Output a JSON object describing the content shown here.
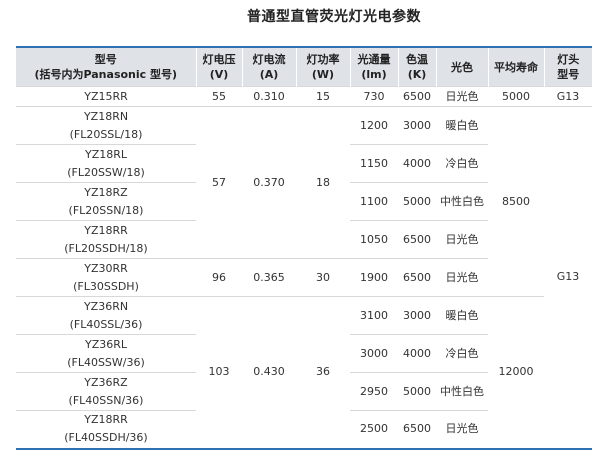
{
  "title": "普通型直管荧光灯光电参数",
  "headers": {
    "model": "型号",
    "model_sub": "(括号内为Panasonic 型号)",
    "voltage": "灯电压",
    "voltage_unit": "(V)",
    "current": "灯电流",
    "current_unit": "(A)",
    "power": "灯功率",
    "power_unit": "(W)",
    "flux": "光通量",
    "flux_unit": "(lm)",
    "cct": "色温",
    "cct_unit": "(K)",
    "color": "光色",
    "life": "平均寿命",
    "base": "灯头",
    "base_sub": "型号"
  },
  "rows": [
    {
      "model": "YZ15RR",
      "pana": "",
      "flux": "730",
      "cct": "6500",
      "color": "日光色"
    },
    {
      "model": "YZ18RN",
      "pana": "(FL20SSL/18)",
      "flux": "1200",
      "cct": "3000",
      "color": "暖白色"
    },
    {
      "model": "YZ18RL",
      "pana": "(FL20SSW/18)",
      "flux": "1150",
      "cct": "4000",
      "color": "冷白色"
    },
    {
      "model": "YZ18RZ",
      "pana": "(FL20SSN/18)",
      "flux": "1100",
      "cct": "5000",
      "color": "中性白色"
    },
    {
      "model": "YZ18RR",
      "pana": "(FL20SSDH/18)",
      "flux": "1050",
      "cct": "6500",
      "color": "日光色"
    },
    {
      "model": "YZ30RR",
      "pana": "(FL30SSDH)",
      "flux": "1900",
      "cct": "6500",
      "color": "日光色"
    },
    {
      "model": "YZ36RN",
      "pana": "(FL40SSL/36)",
      "flux": "3100",
      "cct": "3000",
      "color": "暖白色"
    },
    {
      "model": "YZ36RL",
      "pana": "(FL40SSW/36)",
      "flux": "3000",
      "cct": "4000",
      "color": "冷白色"
    },
    {
      "model": "YZ36RZ",
      "pana": "(FL40SSN/36)",
      "flux": "2950",
      "cct": "5000",
      "color": "中性白色"
    },
    {
      "model": "YZ18RR",
      "pana": "(FL40SSDH/36)",
      "flux": "2500",
      "cct": "6500",
      "color": "日光色"
    }
  ],
  "groups": {
    "g15": {
      "voltage": "55",
      "current": "0.310",
      "power": "15"
    },
    "g18": {
      "voltage": "57",
      "current": "0.370",
      "power": "18"
    },
    "g30": {
      "voltage": "96",
      "current": "0.365",
      "power": "30"
    },
    "g36": {
      "voltage": "103",
      "current": "0.430",
      "power": "36"
    }
  },
  "life": {
    "g15": "5000",
    "g18_30": "8500",
    "g36": "12000"
  },
  "base": {
    "g15": "G13",
    "rest": "G13"
  },
  "colors": {
    "accent_border": "#2f6fb3",
    "header_bg": "#dfe3e8"
  }
}
